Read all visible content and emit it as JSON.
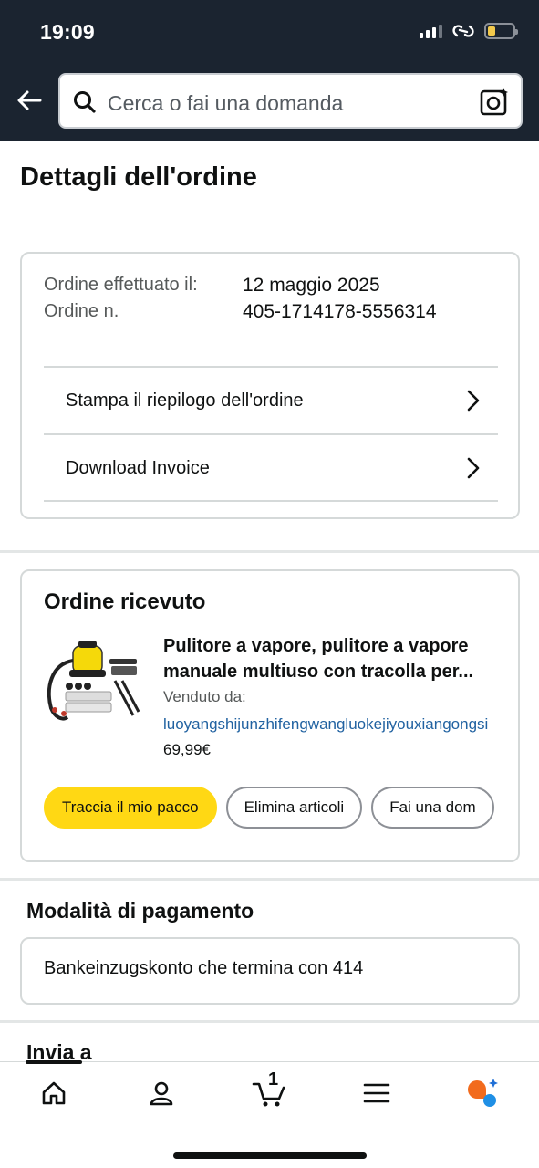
{
  "status_bar": {
    "time": "19:09"
  },
  "search": {
    "placeholder": "Cerca o fai una domanda"
  },
  "page": {
    "title": "Dettagli dell'ordine"
  },
  "order_info": {
    "placed_label": "Ordine effettuato il:",
    "placed_value": "12 maggio 2025",
    "number_label": "Ordine n.",
    "number_value": "405-1714178-5556314",
    "links": [
      {
        "label": "Stampa il riepilogo dell'ordine"
      },
      {
        "label": "Download Invoice"
      }
    ]
  },
  "order_received": {
    "title": "Ordine ricevuto",
    "product": {
      "title": "Pulitore a vapore, pulitore a vapore manuale multiuso con tracolla per...",
      "sold_by_label": "Venduto da:",
      "seller": "luoyangshijunzhifengwangluokejiyouxiangongsi",
      "price": "69,99€"
    },
    "actions": [
      "Traccia il mio pacco",
      "Elimina articoli",
      "Fai una dom"
    ]
  },
  "payment": {
    "title": "Modalità di pagamento",
    "method": "Bankeinzugskonto che termina con 414"
  },
  "shipping": {
    "title": "Invia a"
  },
  "bottom_nav": {
    "items": [
      "home-icon",
      "account-icon",
      "cart-icon",
      "menu-icon",
      "assistant-icon"
    ],
    "cart_count": "1"
  },
  "colors": {
    "header_bg": "#1b2430",
    "primary_button": "#ffd814",
    "link": "#2162a1"
  }
}
